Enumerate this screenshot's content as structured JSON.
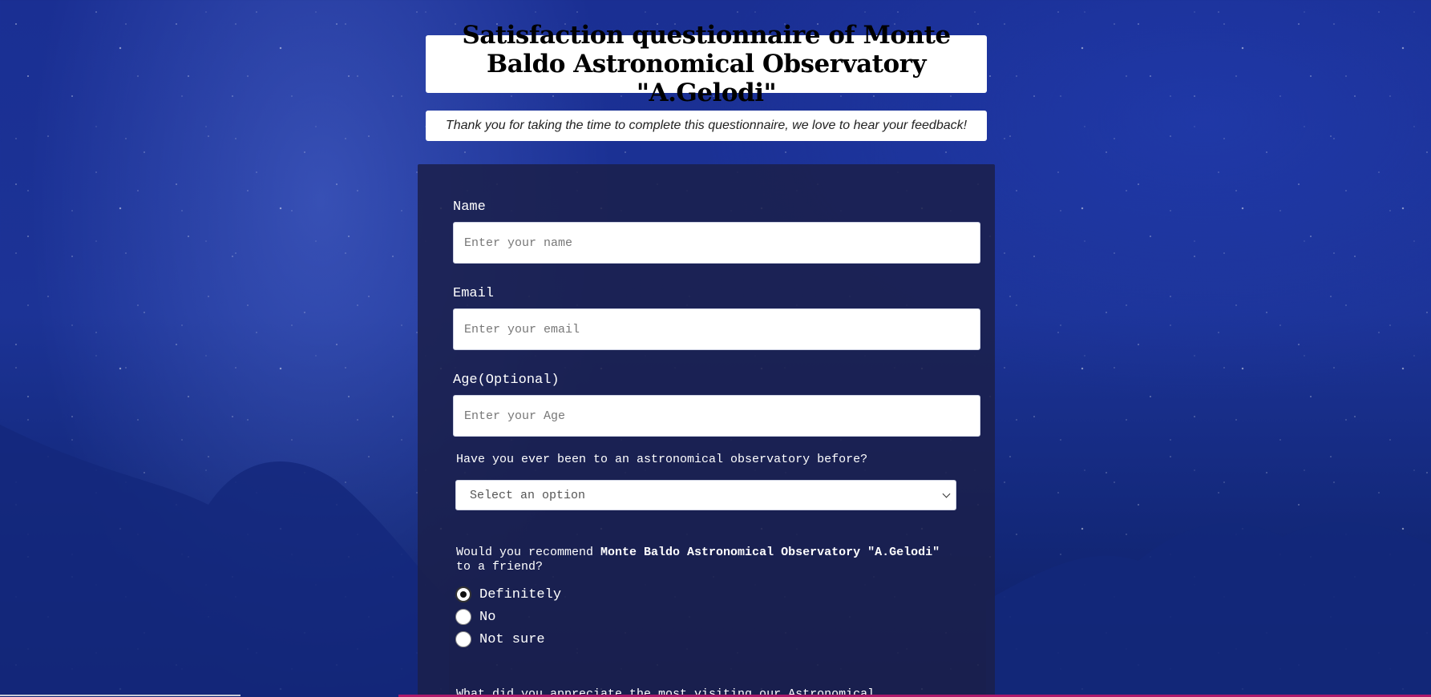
{
  "header": {
    "title": "Satisfaction questionnaire of Monte Baldo Astronomical Observatory \"A.Gelodi\"",
    "subtitle": "Thank you for taking the time to complete this questionnaire, we love to hear your feedback!"
  },
  "form": {
    "name": {
      "label": "Name",
      "placeholder": "Enter your name",
      "value": ""
    },
    "email": {
      "label": "Email",
      "placeholder": "Enter your email",
      "value": ""
    },
    "age": {
      "label": "Age(Optional)",
      "placeholder": "Enter your Age",
      "value": ""
    },
    "visited_before": {
      "question": "Have you ever been to an astronomical observatory before?",
      "selected": "Select an option"
    },
    "recommend": {
      "question_prefix": "Would you recommend ",
      "question_bold": "Monte Baldo Astronomical Observatory \"A.Gelodi\"",
      "question_suffix": " to a friend?",
      "options": [
        {
          "label": "Definitely",
          "checked": true
        },
        {
          "label": "No",
          "checked": false
        },
        {
          "label": "Not sure",
          "checked": false
        }
      ]
    },
    "next_question_partial": "What did you appreciate the most visiting our Astronomical"
  },
  "colors": {
    "background": "#1a2f93",
    "card": "#1b204a",
    "text": "#ffffff"
  }
}
